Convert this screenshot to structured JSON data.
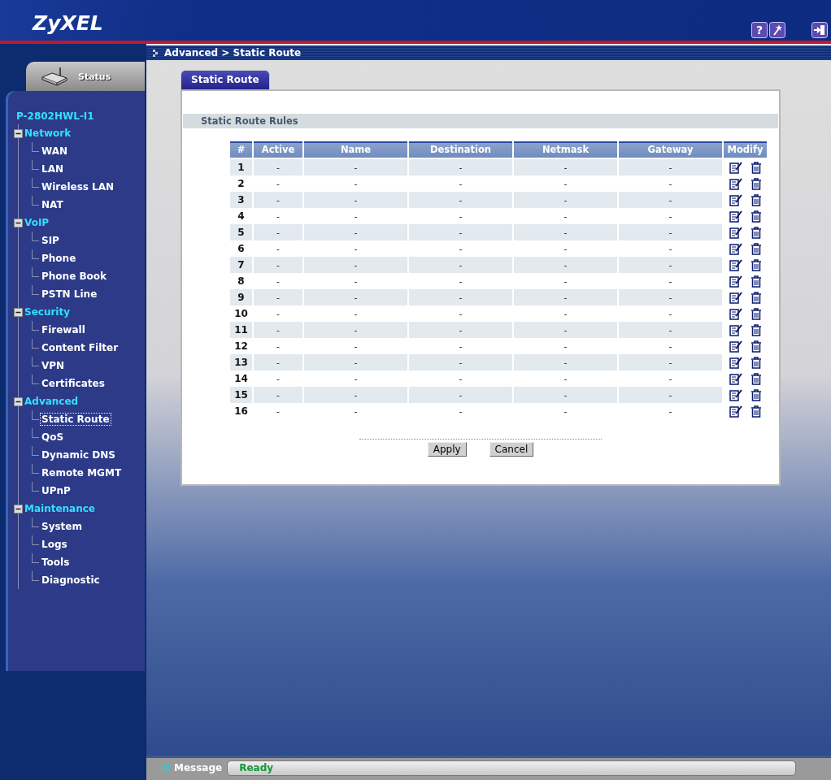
{
  "header": {
    "logo": "ZyXEL",
    "help": "?"
  },
  "sidebar": {
    "status_tab": "Status",
    "device": "P-2802HWL-I1",
    "groups": [
      {
        "label": "Network",
        "expanded": true,
        "children": [
          {
            "label": "WAN",
            "selected": false
          },
          {
            "label": "LAN",
            "selected": false
          },
          {
            "label": "Wireless LAN",
            "selected": false
          },
          {
            "label": "NAT",
            "selected": false
          }
        ]
      },
      {
        "label": "VoIP",
        "expanded": true,
        "children": [
          {
            "label": "SIP",
            "selected": false
          },
          {
            "label": "Phone",
            "selected": false
          },
          {
            "label": "Phone Book",
            "selected": false
          },
          {
            "label": "PSTN Line",
            "selected": false
          }
        ]
      },
      {
        "label": "Security",
        "expanded": true,
        "children": [
          {
            "label": "Firewall",
            "selected": false
          },
          {
            "label": "Content Filter",
            "selected": false
          },
          {
            "label": "VPN",
            "selected": false
          },
          {
            "label": "Certificates",
            "selected": false
          }
        ]
      },
      {
        "label": "Advanced",
        "expanded": true,
        "children": [
          {
            "label": "Static Route",
            "selected": true
          },
          {
            "label": "QoS",
            "selected": false
          },
          {
            "label": "Dynamic DNS",
            "selected": false
          },
          {
            "label": "Remote MGMT",
            "selected": false
          },
          {
            "label": "UPnP",
            "selected": false
          }
        ]
      },
      {
        "label": "Maintenance",
        "expanded": true,
        "children": [
          {
            "label": "System",
            "selected": false
          },
          {
            "label": "Logs",
            "selected": false
          },
          {
            "label": "Tools",
            "selected": false
          },
          {
            "label": "Diagnostic",
            "selected": false
          }
        ]
      }
    ]
  },
  "breadcrumb": "Advanced > Static Route",
  "tabs": [
    {
      "label": "Static Route",
      "selected": true
    }
  ],
  "section_title": "Static Route Rules",
  "table": {
    "columns": [
      "#",
      "Active",
      "Name",
      "Destination",
      "Netmask",
      "Gateway",
      "Modify"
    ],
    "rows": [
      {
        "number": "1",
        "active": "-",
        "name": "-",
        "destination": "-",
        "netmask": "-",
        "gateway": "-"
      },
      {
        "number": "2",
        "active": "-",
        "name": "-",
        "destination": "-",
        "netmask": "-",
        "gateway": "-"
      },
      {
        "number": "3",
        "active": "-",
        "name": "-",
        "destination": "-",
        "netmask": "-",
        "gateway": "-"
      },
      {
        "number": "4",
        "active": "-",
        "name": "-",
        "destination": "-",
        "netmask": "-",
        "gateway": "-"
      },
      {
        "number": "5",
        "active": "-",
        "name": "-",
        "destination": "-",
        "netmask": "-",
        "gateway": "-"
      },
      {
        "number": "6",
        "active": "-",
        "name": "-",
        "destination": "-",
        "netmask": "-",
        "gateway": "-"
      },
      {
        "number": "7",
        "active": "-",
        "name": "-",
        "destination": "-",
        "netmask": "-",
        "gateway": "-"
      },
      {
        "number": "8",
        "active": "-",
        "name": "-",
        "destination": "-",
        "netmask": "-",
        "gateway": "-"
      },
      {
        "number": "9",
        "active": "-",
        "name": "-",
        "destination": "-",
        "netmask": "-",
        "gateway": "-"
      },
      {
        "number": "10",
        "active": "-",
        "name": "-",
        "destination": "-",
        "netmask": "-",
        "gateway": "-"
      },
      {
        "number": "11",
        "active": "-",
        "name": "-",
        "destination": "-",
        "netmask": "-",
        "gateway": "-"
      },
      {
        "number": "12",
        "active": "-",
        "name": "-",
        "destination": "-",
        "netmask": "-",
        "gateway": "-"
      },
      {
        "number": "13",
        "active": "-",
        "name": "-",
        "destination": "-",
        "netmask": "-",
        "gateway": "-"
      },
      {
        "number": "14",
        "active": "-",
        "name": "-",
        "destination": "-",
        "netmask": "-",
        "gateway": "-"
      },
      {
        "number": "15",
        "active": "-",
        "name": "-",
        "destination": "-",
        "netmask": "-",
        "gateway": "-"
      },
      {
        "number": "16",
        "active": "-",
        "name": "-",
        "destination": "-",
        "netmask": "-",
        "gateway": "-"
      }
    ]
  },
  "buttons": [
    "Apply",
    "Cancel"
  ],
  "status_bar": {
    "label": "Message",
    "value": "Ready"
  }
}
